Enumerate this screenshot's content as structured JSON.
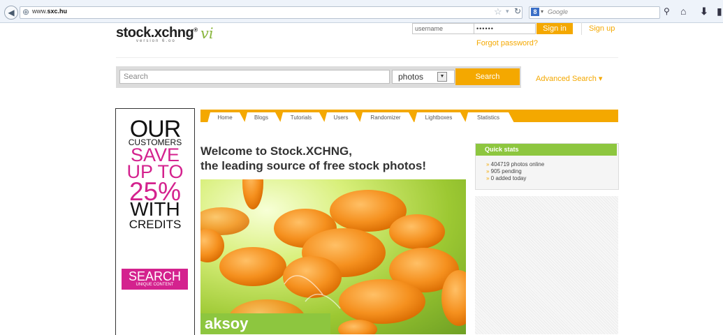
{
  "browser": {
    "url_prefix": "www.",
    "url_domain": "sxc.hu",
    "search_engine": "Google"
  },
  "header": {
    "logo": "stock.xchng",
    "logo_registered": "®",
    "logo_version_mark": "vi",
    "logo_subtitle": "version 6.oo",
    "username_value": "username",
    "password_value": "••••••",
    "signin_label": "Sign in",
    "signup_label": "Sign up",
    "forgot_label": "Forgot password?"
  },
  "search": {
    "placeholder": "Search",
    "type_selected": "photos",
    "button_label": "Search",
    "advanced_label": "Advanced Search ▾"
  },
  "ad": {
    "line1": "OUR",
    "line2": "CUSTOMERS",
    "line3": "SAVE",
    "line4": "UP TO",
    "line5": "25%",
    "line6": "WITH",
    "line7": "CREDITS",
    "button_main": "SEARCH",
    "button_sub": "UNIQUE CONTENT"
  },
  "tabs": [
    "Home",
    "Blogs",
    "Tutorials",
    "Users",
    "Randomizer",
    "Lightboxes",
    "Statistics"
  ],
  "welcome": {
    "line1": "Welcome to Stock.XCHNG,",
    "line2": "the leading source of free stock photos!"
  },
  "photo": {
    "caption": "aksoy"
  },
  "quick_stats": {
    "title": "Quick stats",
    "items": [
      "404719 photos online",
      "905 pending",
      "0 added today"
    ]
  },
  "colors": {
    "accent": "#f4a800",
    "green": "#8dc63f",
    "magenta": "#d4228e"
  }
}
